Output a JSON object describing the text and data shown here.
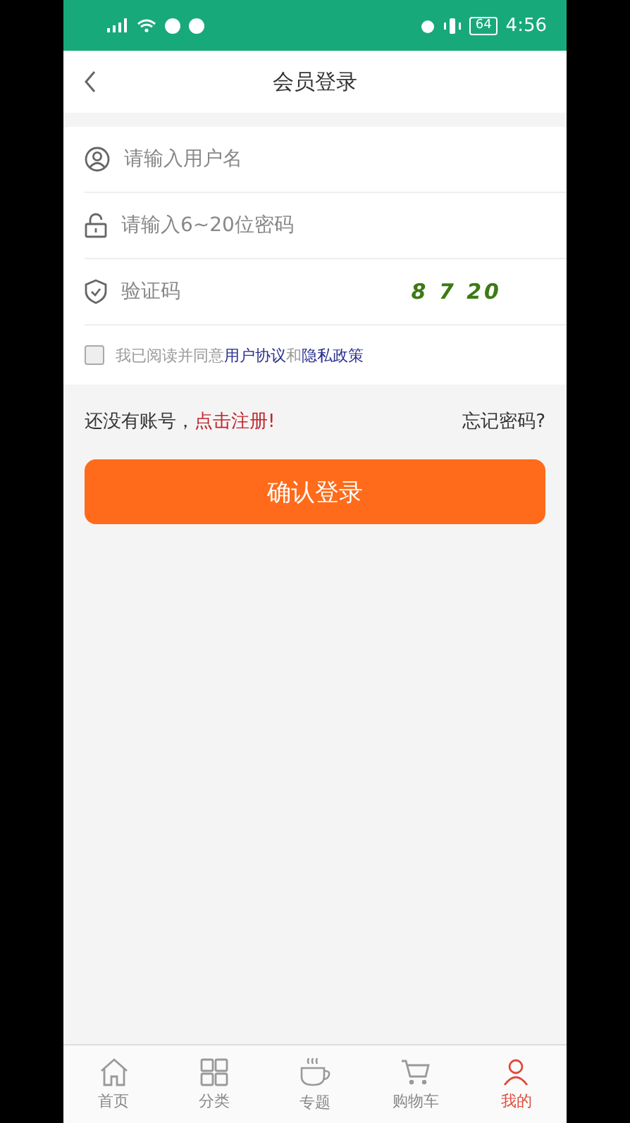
{
  "status_bar": {
    "battery": "64",
    "time": "4:56"
  },
  "header": {
    "title": "会员登录"
  },
  "form": {
    "fields": [
      {
        "kind": "user",
        "placeholder": "请输入用户名"
      },
      {
        "kind": "lock",
        "placeholder": "请输入6~20位密码"
      },
      {
        "kind": "shield",
        "placeholder": "验证码",
        "captcha": "8 7 20"
      }
    ],
    "agreement": {
      "checked": false,
      "text": "我已阅读并同意",
      "link1": "用户协议",
      "joiner": "和",
      "link2": "隐私政策"
    }
  },
  "register": {
    "prompt": "还没有账号，",
    "link": "点击注册!",
    "forgot": "忘记密码?"
  },
  "submit": "确认登录",
  "tabs": [
    {
      "kind": "home",
      "label": "首页",
      "selected": false
    },
    {
      "kind": "grid",
      "label": "分类",
      "selected": false
    },
    {
      "kind": "cup",
      "label": "专题",
      "selected": false
    },
    {
      "kind": "cart",
      "label": "购物车",
      "selected": false
    },
    {
      "kind": "user",
      "label": "我的",
      "selected": true
    }
  ]
}
